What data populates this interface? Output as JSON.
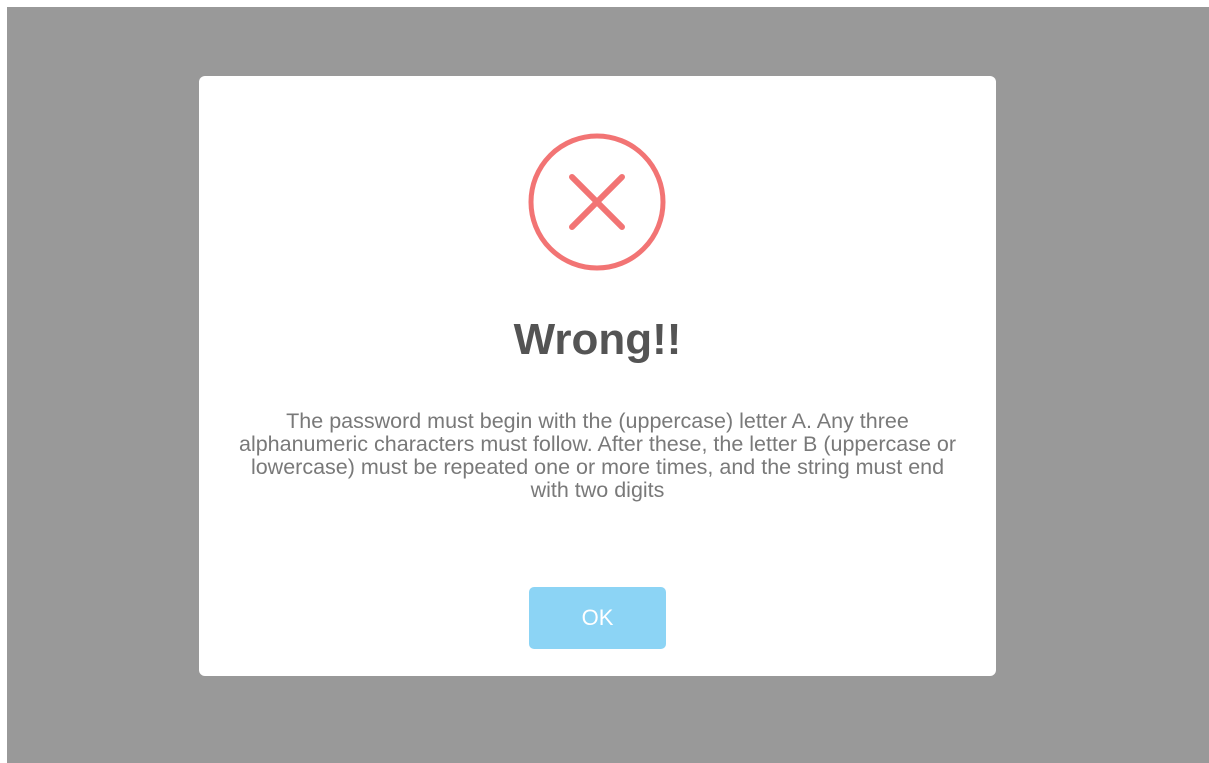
{
  "dialog": {
    "icon": "error-x-icon",
    "title": "Wrong!!",
    "message": "The password must begin with the (uppercase) letter A. Any three alphanumeric characters must follow. After these, the letter B (uppercase or lowercase) must be repeated one or more times, and the string must end with two digits",
    "confirm_label": "OK"
  },
  "colors": {
    "overlay": "#999999",
    "error": "#F27474",
    "button": "#8CD4F5",
    "title_text": "#545454",
    "message_text": "#797979"
  }
}
